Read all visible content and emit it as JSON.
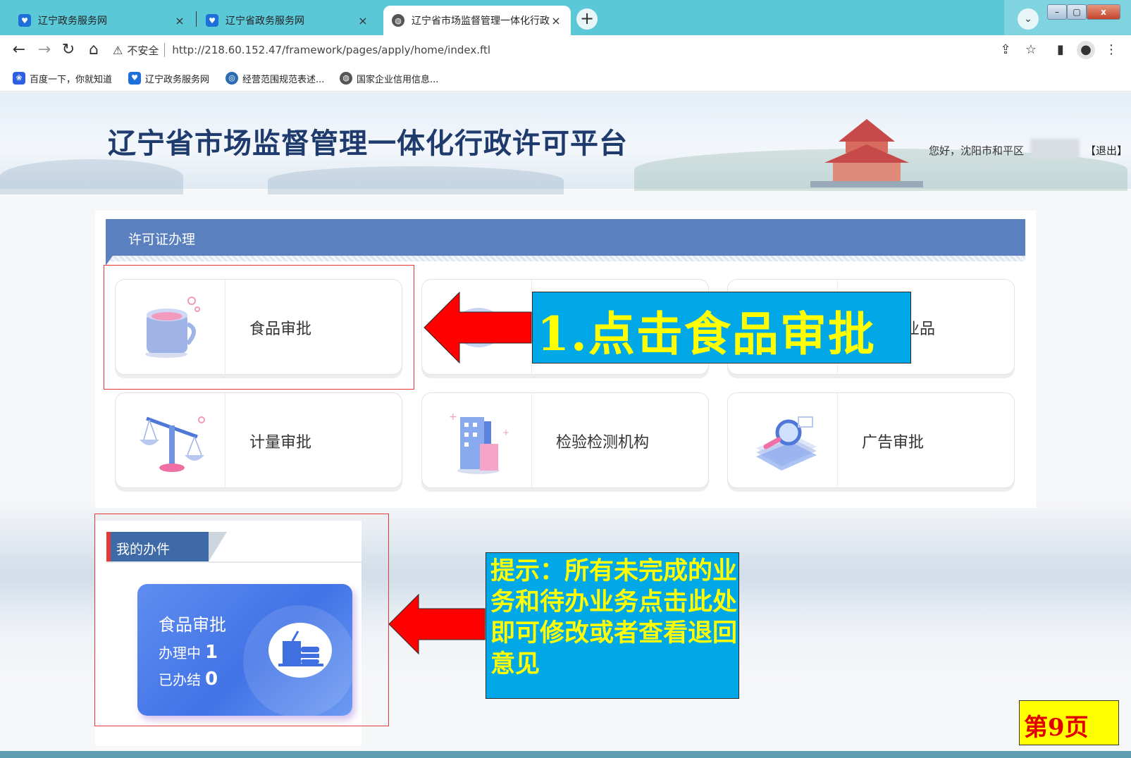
{
  "browser": {
    "tabs": [
      {
        "label": "辽宁政务服务网",
        "active": false,
        "icon": "heart-shield-icon"
      },
      {
        "label": "辽宁省政务服务网",
        "active": false,
        "icon": "heart-shield-icon"
      },
      {
        "label": "辽宁省市场监督管理一体化行政许",
        "active": true,
        "icon": "globe-icon"
      }
    ],
    "close_glyph": "×",
    "new_tab_glyph": "+",
    "tab_dropdown_glyph": "⌄",
    "window_controls": {
      "minimize": "–",
      "maximize": "▢",
      "close": "x"
    },
    "address": {
      "security_label": "不安全",
      "url": "http://218.60.152.47/framework/pages/apply/home/index.ftl"
    },
    "bookmarks": [
      {
        "label": "百度一下，你就知道",
        "icon": "baidu-paw-icon"
      },
      {
        "label": "辽宁政务服务网",
        "icon": "heart-shield-icon"
      },
      {
        "label": "经营范围规范表述...",
        "icon": "circle-logo-icon"
      },
      {
        "label": "国家企业信用信息...",
        "icon": "globe-icon"
      }
    ]
  },
  "header": {
    "title": "辽宁省市场监督管理一体化行政许可平台",
    "greeting": "您好，沈阳市和平区",
    "logout": "【退出】"
  },
  "permit_panel": {
    "title": "许可证办理",
    "cards": [
      {
        "label": "食品审批",
        "icon": "cup-icon"
      },
      {
        "label": "",
        "icon": "pill-capsule-icon"
      },
      {
        "label": "业品",
        "icon": "product-icon"
      },
      {
        "label": "计量审批",
        "icon": "balance-scale-icon"
      },
      {
        "label": "检验检测机构",
        "icon": "building-icon"
      },
      {
        "label": "广告审批",
        "icon": "magnifier-document-icon"
      }
    ]
  },
  "my_work": {
    "title": "我的办件",
    "tile": {
      "title": "食品审批",
      "in_progress_label": "办理中",
      "in_progress_count": "1",
      "done_label": "已办结",
      "done_count": "0",
      "icon": "drink-cup-icon"
    }
  },
  "annotations": {
    "callout_1": "1.点击食品审批",
    "callout_2": "提示：所有未完成的业务和待办业务点击此处即可修改或者查看退回意见",
    "page_number": "第9页"
  },
  "colors": {
    "tabbar": "#5bc8d8",
    "panel_header": "#5a80c0",
    "callout_bg": "#00a8e8",
    "callout_text": "#ffff00",
    "arrow": "#ff0000",
    "highlight_border": "#e53935"
  }
}
